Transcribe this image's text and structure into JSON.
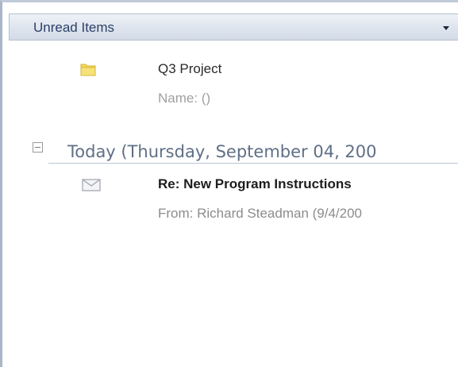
{
  "header": {
    "title": "Unread Items",
    "dropdown_icon": "chevron-down-icon"
  },
  "items": [
    {
      "icon": "folder-icon",
      "title": "Q3 Project",
      "subtitle": "Name: ()"
    }
  ],
  "groups": [
    {
      "label": "Today (Thursday, September 04, 200",
      "toggle_icon": "collapse-icon",
      "messages": [
        {
          "icon": "envelope-icon",
          "subject": "Re: New Program Instructions",
          "from": "From: Richard Steadman (9/4/200"
        }
      ]
    }
  ],
  "colors": {
    "header_text": "#2b3f66",
    "group_text": "#5f6f86",
    "folder": "#f2d45a"
  }
}
